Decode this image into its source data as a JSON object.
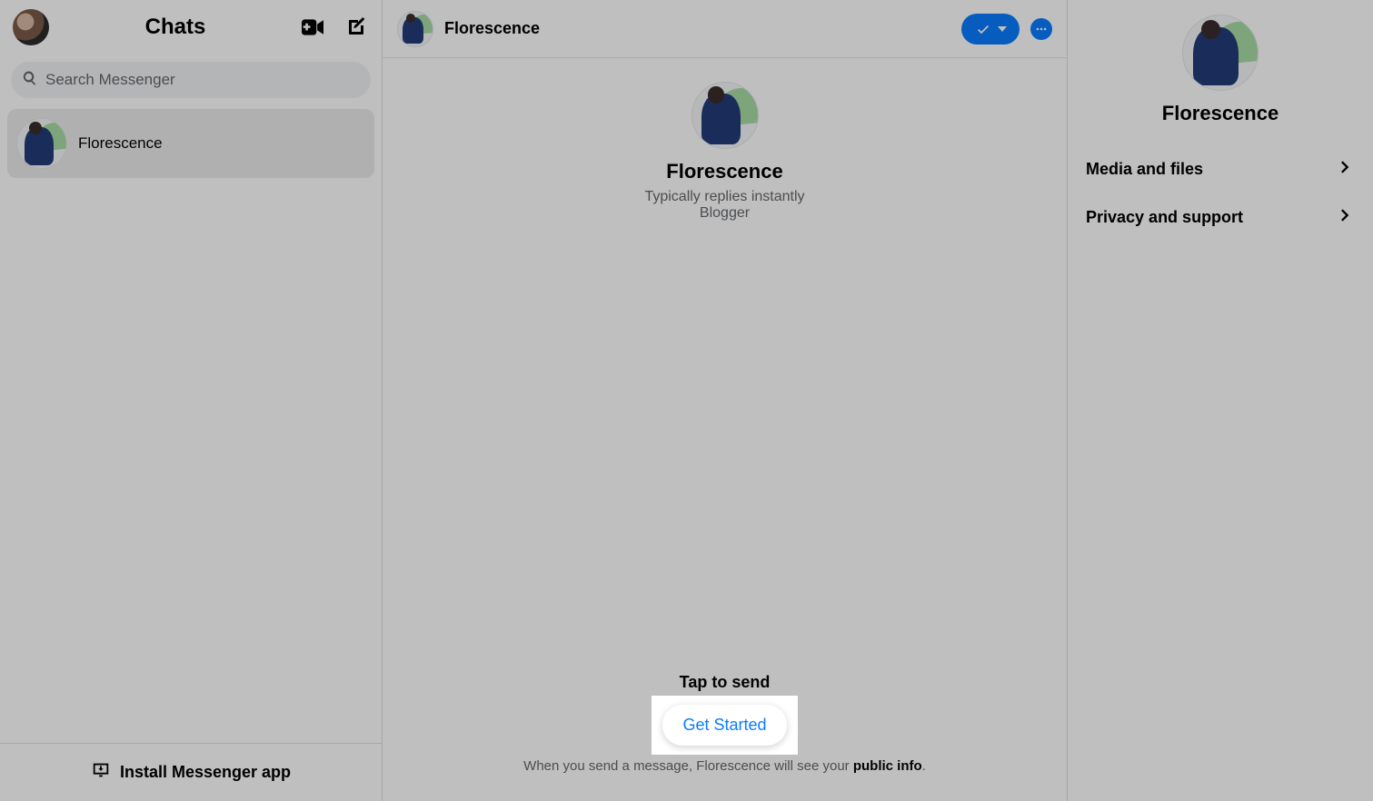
{
  "sidebar": {
    "title": "Chats",
    "search_placeholder": "Search Messenger",
    "conversations": [
      {
        "name": "Florescence"
      }
    ],
    "install_label": "Install Messenger app"
  },
  "conversation": {
    "header": {
      "title": "Florescence"
    },
    "contact": {
      "name": "Florescence",
      "reply_info": "Typically replies instantly",
      "category": "Blogger"
    },
    "footer": {
      "tap_label": "Tap to send",
      "get_started_label": "Get Started",
      "disclosure_pre": "When you send a message, Florescence will see your ",
      "disclosure_link": "public info",
      "disclosure_post": "."
    }
  },
  "info_panel": {
    "name": "Florescence",
    "rows": [
      {
        "label": "Media and files"
      },
      {
        "label": "Privacy and support"
      }
    ]
  }
}
